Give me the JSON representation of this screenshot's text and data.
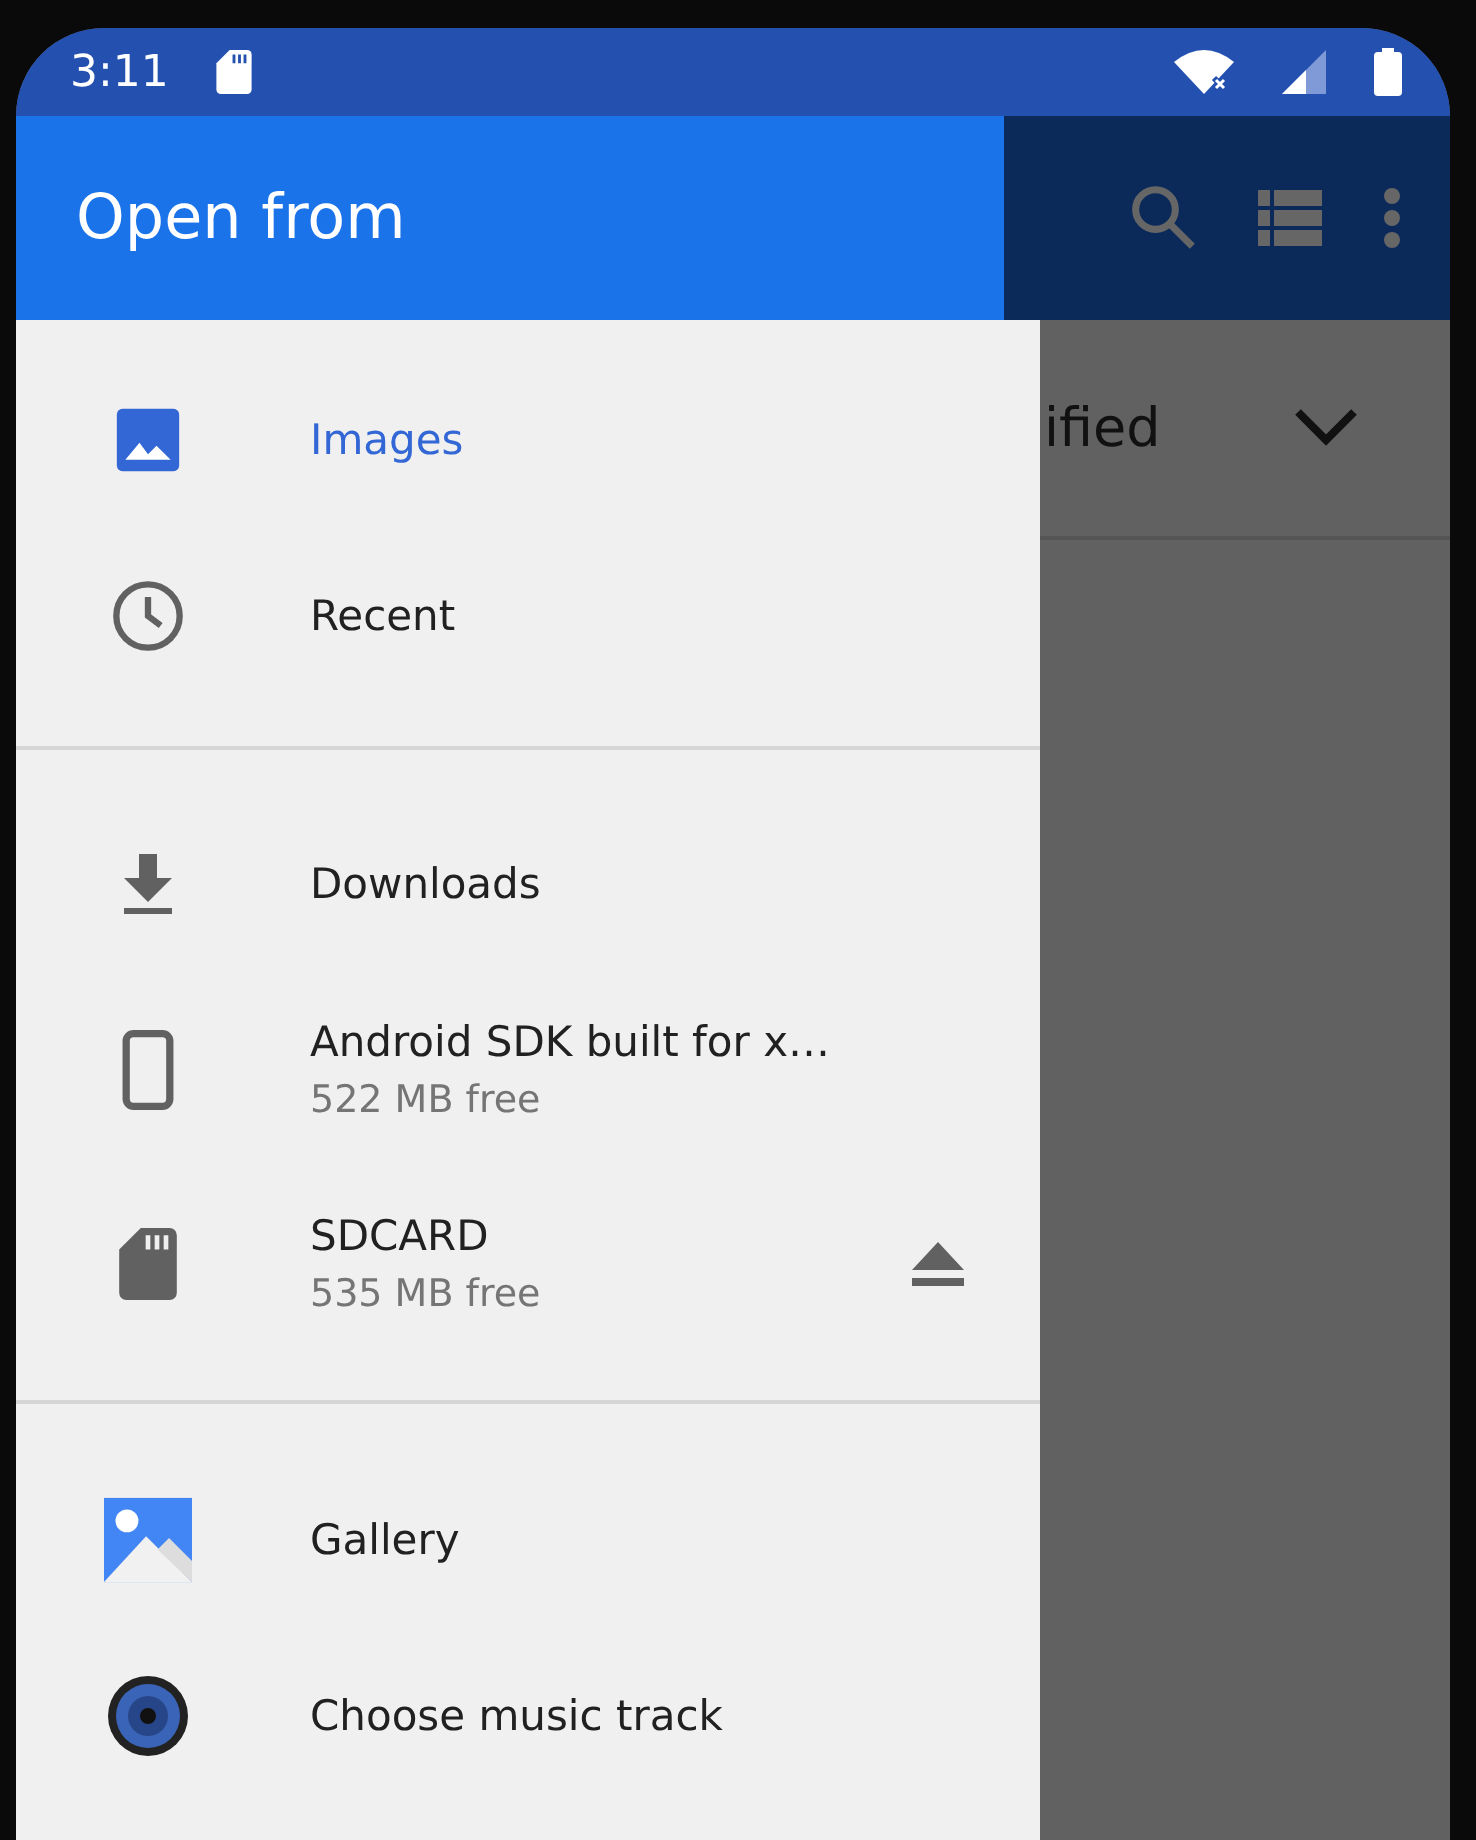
{
  "status_bar": {
    "time": "3:11"
  },
  "drawer": {
    "title": "Open from",
    "sections": [
      {
        "items": [
          {
            "label": "Images",
            "selected": true,
            "ejectable": false
          },
          {
            "label": "Recent",
            "selected": false,
            "ejectable": false
          }
        ]
      },
      {
        "items": [
          {
            "label": "Downloads",
            "selected": false,
            "ejectable": false
          },
          {
            "label": "Android SDK built for x…",
            "subtitle": "522 MB free",
            "selected": false,
            "ejectable": false
          },
          {
            "label": "SDCARD",
            "subtitle": "535 MB free",
            "selected": false,
            "ejectable": true
          }
        ]
      },
      {
        "items": [
          {
            "label": "Gallery",
            "selected": false,
            "ejectable": false
          },
          {
            "label": "Choose music track",
            "selected": false,
            "ejectable": false
          }
        ]
      }
    ]
  },
  "background": {
    "sort_label": "ified"
  }
}
